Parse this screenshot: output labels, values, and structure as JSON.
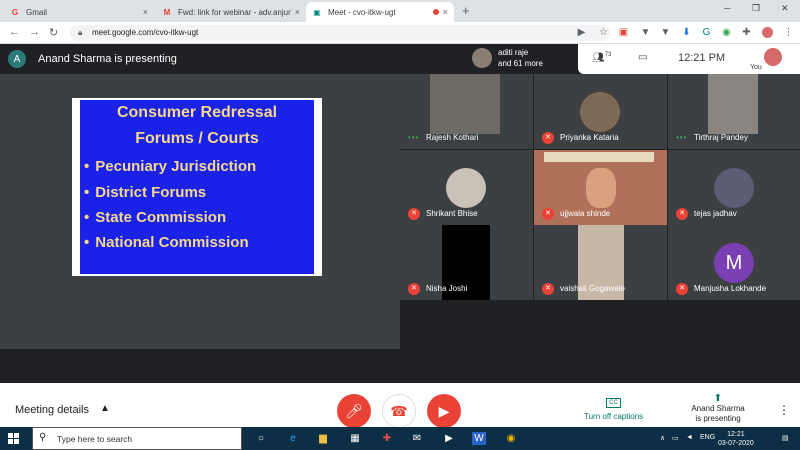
{
  "browser": {
    "tabs": [
      {
        "icon": "G",
        "title": "Gmail",
        "color": "#ea4335"
      },
      {
        "icon": "M",
        "title": "Fwd: link for webinar - adv.anjum",
        "color": "#ea4335"
      },
      {
        "icon": "▣",
        "title": "Meet - cvo-itkw-ugt",
        "color": "#00897b"
      }
    ],
    "url": "meet.google.com/cvo-itkw-ugt",
    "close_glyph": "×",
    "new_tab_glyph": "+"
  },
  "meet": {
    "presenter_initial": "A",
    "presenter_text": "Anand Sharma is presenting",
    "others_line1": "aditi raje",
    "others_line2": "and 61 more",
    "participant_count": "73",
    "time": "12:21 PM",
    "you_label": "You",
    "slide": {
      "title_line1": "Consumer Redressal",
      "title_line2": "Forums / Courts",
      "bullets": [
        "Pecuniary Jurisdiction",
        "District Forums",
        "State Commission",
        "National Commission"
      ],
      "bullet_glyph": "•"
    },
    "participants": [
      {
        "name": "Rajesh Kothari",
        "status": "speaking"
      },
      {
        "name": "Priyanka Kataria",
        "status": "muted"
      },
      {
        "name": "Tirthraj Pandey",
        "status": "speaking"
      },
      {
        "name": "Shrikant Bhise",
        "status": "muted"
      },
      {
        "name": "ujjwala shinde",
        "status": "muted"
      },
      {
        "name": "tejas jadhav",
        "status": "muted"
      },
      {
        "name": "Nisha Joshi",
        "status": "muted"
      },
      {
        "name": "vaishali Gogawale",
        "status": "muted"
      },
      {
        "name": "Manjusha Lokhande",
        "status": "muted",
        "initial": "M"
      }
    ],
    "bottom": {
      "meeting_details": "Meeting details",
      "captions_label": "Turn off captions",
      "cc_badge": "CC",
      "presenting_line1": "Anand Sharma",
      "presenting_line2": "is presenting"
    }
  },
  "taskbar": {
    "search_placeholder": "Type here to search",
    "lang": "ENG",
    "time": "12:21",
    "date": "03-07-2020"
  },
  "colors": {
    "meet_bg": "#202124",
    "slide_bg": "#1a22e8",
    "slide_text": "#f5d78e",
    "mute_red": "#ea4335",
    "caption_green": "#00796b"
  }
}
